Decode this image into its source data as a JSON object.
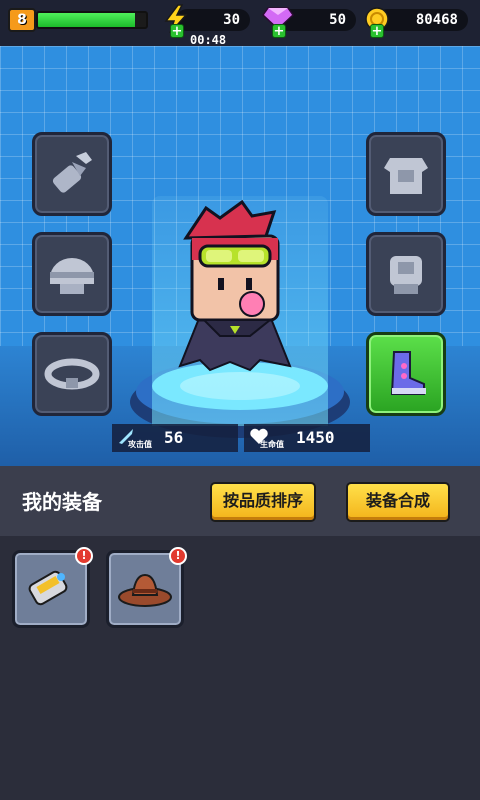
{
  "player": {
    "level": "8",
    "hp_fraction": 0.9
  },
  "resources": {
    "energy": "30",
    "gems": "50",
    "gold": "80468",
    "timer": "00:48"
  },
  "stats": {
    "attack": "56",
    "attack_label": "攻击值",
    "health": "1450",
    "health_label": "生命值"
  },
  "equipment_panel": {
    "title": "我的装备",
    "sort_button": "按品质排序",
    "merge_button": "装备合成"
  },
  "slots": {
    "left": [
      "glove-arm-icon",
      "helmet-icon",
      "belt-icon"
    ],
    "right": [
      "armor-icon",
      "gauntlet-icon",
      "boots-icon"
    ],
    "equipped": [
      "boots-icon"
    ]
  },
  "inventory": [
    {
      "icon": "gauntlet-item-icon",
      "alert": "!"
    },
    {
      "icon": "cowboy-hat-icon",
      "alert": "!"
    }
  ],
  "colors": {
    "accent_yellow": "#f3b31a",
    "hp_green": "#1cbc2a",
    "stage_blue": "#2f8fe0",
    "equipped_green": "#2aa322"
  }
}
